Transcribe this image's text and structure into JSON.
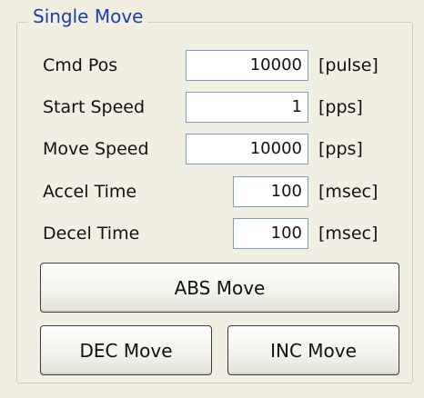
{
  "group": {
    "title": "Single Move"
  },
  "fields": {
    "cmd_pos": {
      "label": "Cmd Pos",
      "value": "10000",
      "unit": "[pulse]"
    },
    "start_speed": {
      "label": "Start Speed",
      "value": "1",
      "unit": "[pps]"
    },
    "move_speed": {
      "label": "Move Speed",
      "value": "10000",
      "unit": "[pps]"
    },
    "accel_time": {
      "label": "Accel Time",
      "value": "100",
      "unit": "[msec]"
    },
    "decel_time": {
      "label": "Decel Time",
      "value": "100",
      "unit": "[msec]"
    }
  },
  "buttons": {
    "abs_move": "ABS Move",
    "dec_move": "DEC Move",
    "inc_move": "INC Move"
  }
}
